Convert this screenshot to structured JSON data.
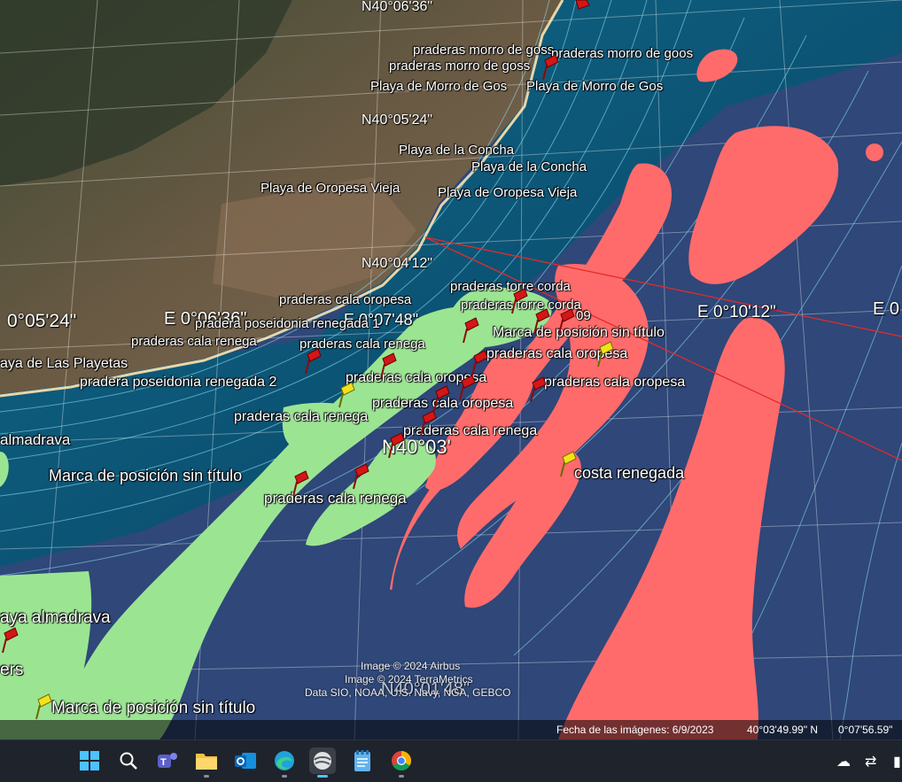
{
  "map": {
    "placemarks": [
      "praderas morro de goss",
      "praderas morro de goos",
      "praderas morro de goss",
      "Playa de Morro de Gos",
      "Playa de Morro de Gos",
      "Playa de la Concha",
      "Playa de la Concha",
      "Playa de Oropesa Vieja",
      "Playa de Oropesa Vieja",
      "praderas torre corda",
      "praderas cala oropesa",
      "praderas torre corda",
      "pradera poseidonia renegada 1",
      "Marca de posición sin título",
      "praderas cala renega",
      "praderas cala renega",
      "praderas cala oropesa",
      "aya de Las Playetas",
      "pradera poseidonia renegada 2",
      "praderas cala oropesa",
      "praderas cala oropesa",
      "praderas cala oropesa",
      "almadrava",
      "praderas cala renega",
      "praderas cala renega",
      "costa renegada",
      "Marca de posición sin título",
      "praderas cala renega",
      "aya almadrava",
      "ers",
      "Marca de posición sin título",
      "09"
    ],
    "coordinates": [
      "N40°06'36\"",
      "N40°05'24\"",
      "N40°04'12\"",
      "0°05'24\"",
      "E  0°06'36\"",
      "E  0°07'48\"",
      "E  0°10'12\"",
      "E  0",
      "N40°03'",
      "N40°01'48\""
    ],
    "credits": [
      "Image © 2024 Airbus",
      "Image © 2024 TerraMetrics",
      "Data SIO, NOAA, U.S. Navy, NGA, GEBCO"
    ]
  },
  "status": {
    "imagery_date": "Fecha de las imágenes: 6/9/2023",
    "latitude": "40°03'49.99\" N",
    "longitude": "0°07'56.59\""
  },
  "taskbar": {
    "apps": [
      "windows-start",
      "search",
      "teams",
      "file-explorer",
      "outlook",
      "edge",
      "google-earth",
      "notepad",
      "chrome"
    ],
    "active_app": "google-earth"
  },
  "colors": {
    "seagrass": "#9be592",
    "sand": "#ff6b6b",
    "deep_sea": "#2f4779",
    "shallow_sea": "#0e5f7e",
    "contour": "#8fe3f5"
  }
}
